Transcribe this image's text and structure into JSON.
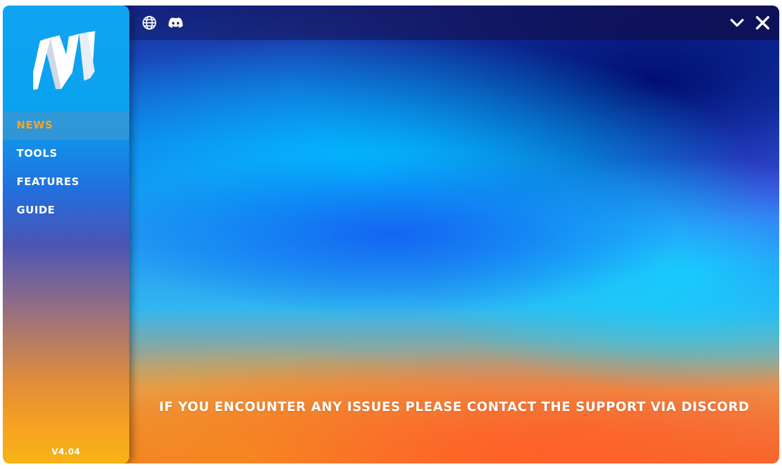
{
  "sidebar": {
    "logo_icon": "nv-logo",
    "items": [
      {
        "label": "NEWS",
        "active": true
      },
      {
        "label": "TOOLS",
        "active": false
      },
      {
        "label": "FEATURES",
        "active": false
      },
      {
        "label": "GUIDE",
        "active": false
      }
    ],
    "version": "V4.04"
  },
  "topbar": {
    "left_icons": [
      "globe-icon",
      "discord-icon"
    ],
    "right_icons": [
      "chevron-down-icon",
      "close-icon"
    ]
  },
  "main": {
    "notice": "IF YOU ENCOUNTER ANY ISSUES PLEASE CONTACT THE SUPPORT VIA DISCORD"
  },
  "colors": {
    "active_nav": "#f5a623",
    "text": "#ffffff",
    "sidebar_top": "#0fa4f2",
    "sidebar_bottom": "#f6b317"
  }
}
